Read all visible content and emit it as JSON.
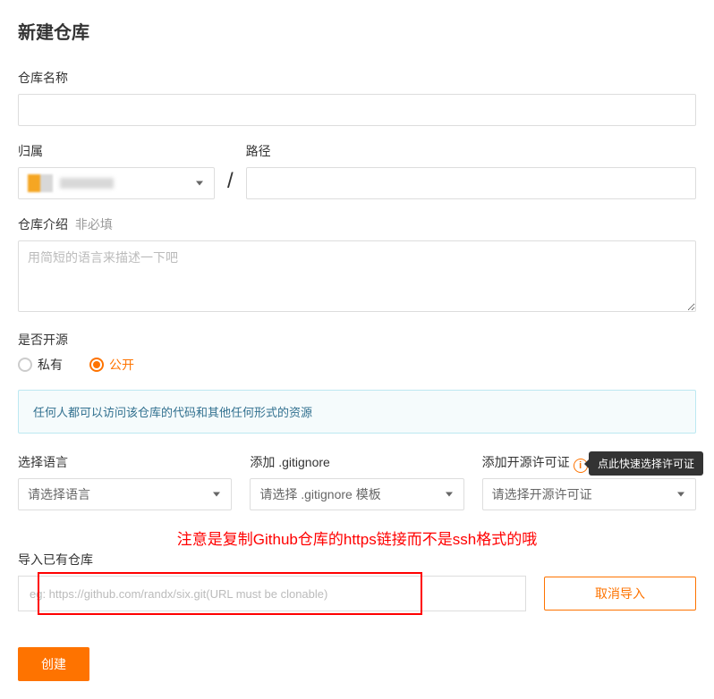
{
  "title": "新建仓库",
  "repo_name": {
    "label": "仓库名称",
    "value": ""
  },
  "owner": {
    "label": "归属"
  },
  "path": {
    "label": "路径",
    "value": ""
  },
  "description": {
    "label": "仓库介绍",
    "optional": "非必填",
    "placeholder": "用简短的语言来描述一下吧"
  },
  "open_source": {
    "label": "是否开源",
    "options": {
      "private": "私有",
      "public": "公开"
    },
    "info": "任何人都可以访问该仓库的代码和其他任何形式的资源"
  },
  "language": {
    "label": "选择语言",
    "placeholder": "请选择语言"
  },
  "gitignore": {
    "label": "添加 .gitignore",
    "placeholder": "请选择 .gitignore 模板"
  },
  "license": {
    "label": "添加开源许可证",
    "placeholder": "请选择开源许可证",
    "tooltip": "点此快速选择许可证"
  },
  "annotation": "注意是复制Github仓库的https链接而不是ssh格式的哦",
  "import": {
    "label": "导入已有仓库",
    "placeholder": "eg: https://github.com/randx/six.git(URL must be clonable)",
    "cancel": "取消导入"
  },
  "create_button": "创建"
}
